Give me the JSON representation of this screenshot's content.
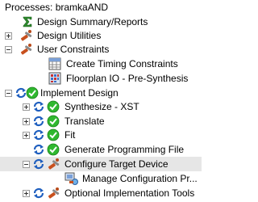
{
  "panel": {
    "title": "Processes: bramkaAND"
  },
  "tree": {
    "items": [
      {
        "label": "Design Summary/Reports"
      },
      {
        "label": "Design Utilities"
      },
      {
        "label": "User Constraints"
      },
      {
        "label": "Create Timing Constraints"
      },
      {
        "label": "Floorplan IO - Pre-Synthesis"
      },
      {
        "label": "Implement Design"
      },
      {
        "label": "Synthesize - XST"
      },
      {
        "label": "Translate"
      },
      {
        "label": "Fit"
      },
      {
        "label": "Generate Programming File"
      },
      {
        "label": "Configure Target Device"
      },
      {
        "label": "Manage Configuration Pr..."
      },
      {
        "label": "Optional Implementation Tools"
      }
    ]
  },
  "colors": {
    "ok_green": "#2fb82f",
    "sync_blue": "#1f5fbf",
    "selection": "#e6e6e6"
  },
  "icons": {
    "summary": "sigma-icon",
    "utilities": "tools-icon",
    "constraints": "tools-icon",
    "timing": "grid-icon",
    "floorplan": "chip-grid-icon",
    "status": "check-icon",
    "refresh": "refresh-icon"
  }
}
